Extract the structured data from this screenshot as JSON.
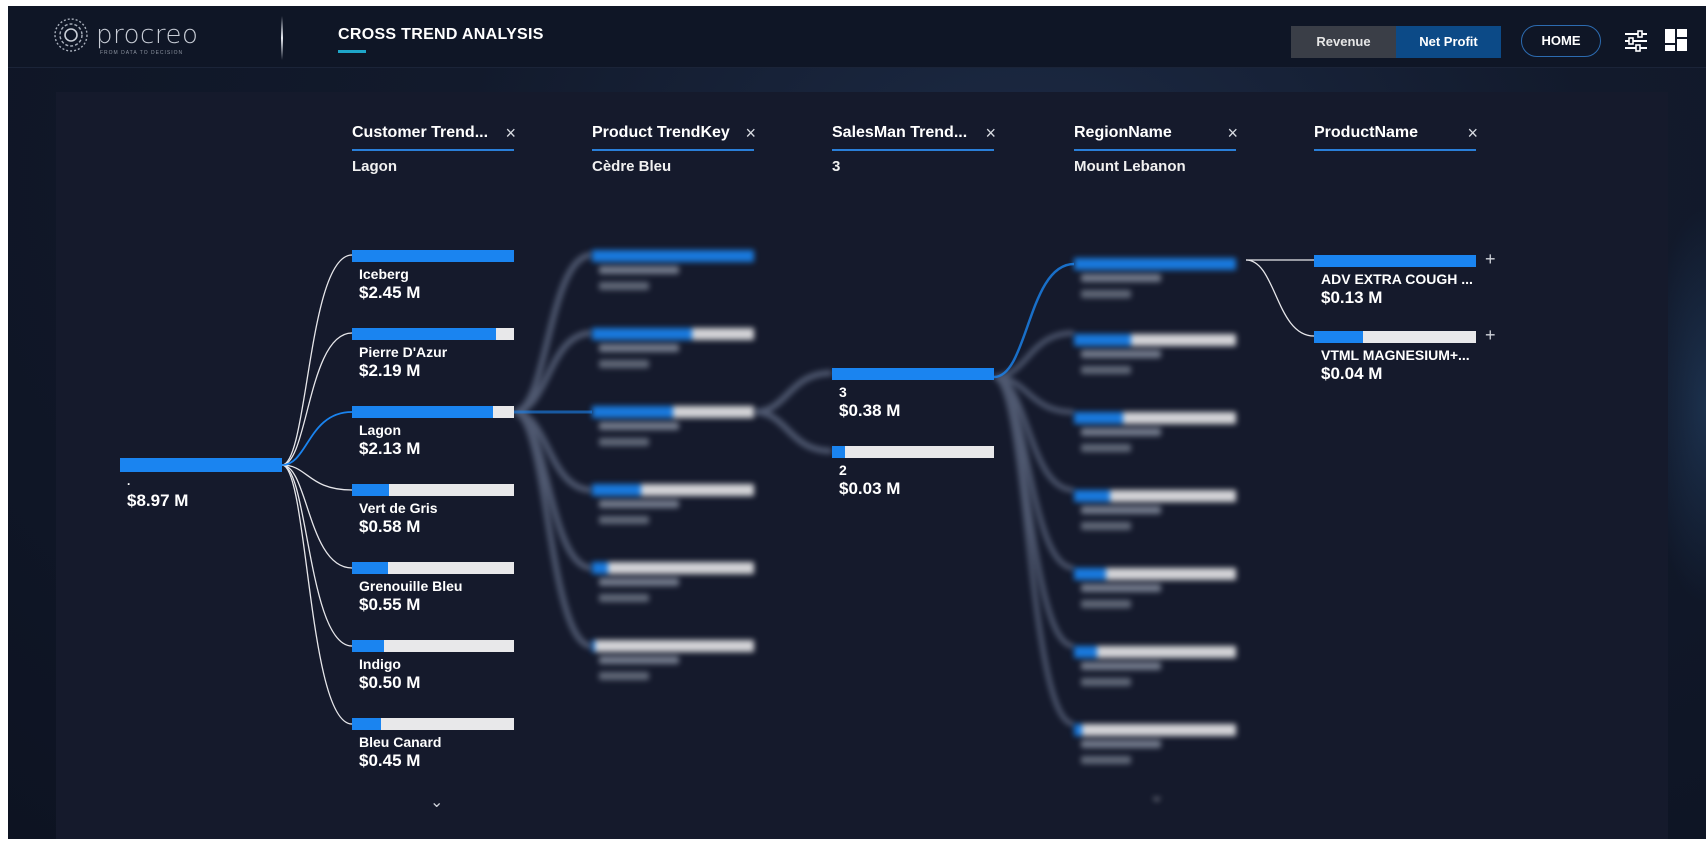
{
  "header": {
    "logo_text": "procreo",
    "logo_tm": "™",
    "logo_tagline": "FROM DATA TO DECISION",
    "page_title": "CROSS TREND ANALYSIS",
    "toggle": {
      "revenue": "Revenue",
      "net_profit": "Net Profit",
      "active": "Net Profit"
    },
    "home_label": "HOME",
    "icons": {
      "filters": "sliders-icon",
      "layout": "grid-layout-icon"
    }
  },
  "colors": {
    "accent": "#1a84f0",
    "bar_bg": "#e8e8ea",
    "panel_bg": "#151a2c",
    "header_line": "#2a7fd8",
    "toggle_active": "#0c4a87"
  },
  "tree": {
    "root": {
      "label": ".",
      "value": "$8.97 M"
    },
    "columns": [
      {
        "name": "Customer Trend...",
        "selected": "Lagon"
      },
      {
        "name": "Product TrendKey",
        "selected": "Cèdre Bleu"
      },
      {
        "name": "SalesMan Trend...",
        "selected": "3"
      },
      {
        "name": "RegionName",
        "selected": "Mount Lebanon"
      },
      {
        "name": "ProductName",
        "selected": ""
      }
    ],
    "customer_nodes": [
      {
        "label": "Iceberg",
        "value": "$2.45 M",
        "fill": 1.0
      },
      {
        "label": "Pierre D'Azur",
        "value": "$2.19 M",
        "fill": 0.89
      },
      {
        "label": "Lagon",
        "value": "$2.13 M",
        "fill": 0.87
      },
      {
        "label": "Vert de Gris",
        "value": "$0.58 M",
        "fill": 0.23
      },
      {
        "label": "Grenouille Bleu",
        "value": "$0.55 M",
        "fill": 0.22
      },
      {
        "label": "Indigo",
        "value": "$0.50 M",
        "fill": 0.2
      },
      {
        "label": "Bleu Canard",
        "value": "$0.45 M",
        "fill": 0.18
      }
    ],
    "salesman_nodes": [
      {
        "label": "3",
        "value": "$0.38 M",
        "fill": 1.0
      },
      {
        "label": "2",
        "value": "$0.03 M",
        "fill": 0.08
      }
    ],
    "product_nodes": [
      {
        "label": "ADV EXTRA COUGH ...",
        "value": "$0.13 M",
        "fill": 1.0
      },
      {
        "label": "VTML MAGNESIUM+...",
        "value": "$0.04 M",
        "fill": 0.3
      }
    ],
    "plus_label": "+",
    "close_label": "×",
    "more_label": "⌄"
  }
}
